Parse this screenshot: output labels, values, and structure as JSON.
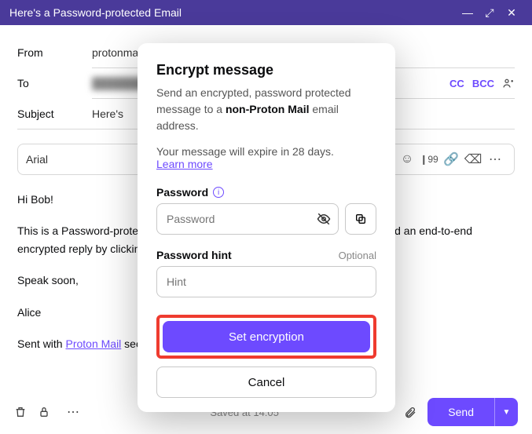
{
  "titlebar": {
    "title": "Here's a Password-protected Email"
  },
  "from": {
    "label": "From",
    "value": "protonmailtutorials@protonmail.com"
  },
  "to": {
    "label": "To",
    "value": "██████████",
    "cc": "CC",
    "bcc": "BCC"
  },
  "subject": {
    "label": "Subject",
    "value": "Here's"
  },
  "toolbar": {
    "font": "Arial"
  },
  "body": {
    "greeting": "Hi Bob!",
    "line1": "This is a Password-protected Email from Proton Mail. You can read it and send an end-to-end encrypted reply by clicking the button below.",
    "line2": "Speak soon,",
    "signoff": "Alice",
    "sentwith_prefix": "Sent with ",
    "sentwith_link": "Proton Mail",
    "sentwith_suffix": " secure email."
  },
  "bottombar": {
    "saved": "Saved at 14:05",
    "send": "Send"
  },
  "modal": {
    "title": "Encrypt message",
    "desc_pre": "Send an encrypted, password protected message to a ",
    "desc_bold": "non-Proton Mail",
    "desc_post": " email address.",
    "expiry": "Your message will expire in 28 days.",
    "learn": "Learn more",
    "password_label": "Password",
    "password_placeholder": "Password",
    "hint_label": "Password hint",
    "hint_optional": "Optional",
    "hint_placeholder": "Hint",
    "set_btn": "Set encryption",
    "cancel_btn": "Cancel"
  }
}
